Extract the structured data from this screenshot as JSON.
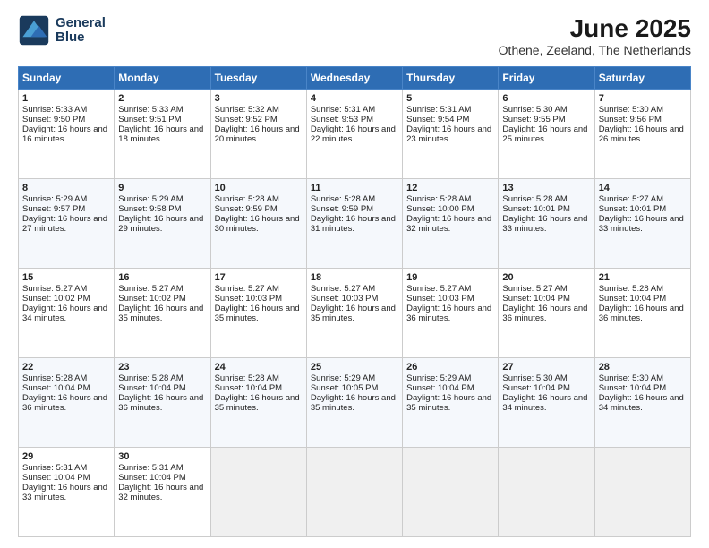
{
  "logo": {
    "line1": "General",
    "line2": "Blue"
  },
  "title": "June 2025",
  "subtitle": "Othene, Zeeland, The Netherlands",
  "weekdays": [
    "Sunday",
    "Monday",
    "Tuesday",
    "Wednesday",
    "Thursday",
    "Friday",
    "Saturday"
  ],
  "weeks": [
    [
      {
        "day": "1",
        "sunrise": "5:33 AM",
        "sunset": "9:50 PM",
        "daylight": "16 hours and 16 minutes."
      },
      {
        "day": "2",
        "sunrise": "5:33 AM",
        "sunset": "9:51 PM",
        "daylight": "16 hours and 18 minutes."
      },
      {
        "day": "3",
        "sunrise": "5:32 AM",
        "sunset": "9:52 PM",
        "daylight": "16 hours and 20 minutes."
      },
      {
        "day": "4",
        "sunrise": "5:31 AM",
        "sunset": "9:53 PM",
        "daylight": "16 hours and 22 minutes."
      },
      {
        "day": "5",
        "sunrise": "5:31 AM",
        "sunset": "9:54 PM",
        "daylight": "16 hours and 23 minutes."
      },
      {
        "day": "6",
        "sunrise": "5:30 AM",
        "sunset": "9:55 PM",
        "daylight": "16 hours and 25 minutes."
      },
      {
        "day": "7",
        "sunrise": "5:30 AM",
        "sunset": "9:56 PM",
        "daylight": "16 hours and 26 minutes."
      }
    ],
    [
      {
        "day": "8",
        "sunrise": "5:29 AM",
        "sunset": "9:57 PM",
        "daylight": "16 hours and 27 minutes."
      },
      {
        "day": "9",
        "sunrise": "5:29 AM",
        "sunset": "9:58 PM",
        "daylight": "16 hours and 29 minutes."
      },
      {
        "day": "10",
        "sunrise": "5:28 AM",
        "sunset": "9:59 PM",
        "daylight": "16 hours and 30 minutes."
      },
      {
        "day": "11",
        "sunrise": "5:28 AM",
        "sunset": "9:59 PM",
        "daylight": "16 hours and 31 minutes."
      },
      {
        "day": "12",
        "sunrise": "5:28 AM",
        "sunset": "10:00 PM",
        "daylight": "16 hours and 32 minutes."
      },
      {
        "day": "13",
        "sunrise": "5:28 AM",
        "sunset": "10:01 PM",
        "daylight": "16 hours and 33 minutes."
      },
      {
        "day": "14",
        "sunrise": "5:27 AM",
        "sunset": "10:01 PM",
        "daylight": "16 hours and 33 minutes."
      }
    ],
    [
      {
        "day": "15",
        "sunrise": "5:27 AM",
        "sunset": "10:02 PM",
        "daylight": "16 hours and 34 minutes."
      },
      {
        "day": "16",
        "sunrise": "5:27 AM",
        "sunset": "10:02 PM",
        "daylight": "16 hours and 35 minutes."
      },
      {
        "day": "17",
        "sunrise": "5:27 AM",
        "sunset": "10:03 PM",
        "daylight": "16 hours and 35 minutes."
      },
      {
        "day": "18",
        "sunrise": "5:27 AM",
        "sunset": "10:03 PM",
        "daylight": "16 hours and 35 minutes."
      },
      {
        "day": "19",
        "sunrise": "5:27 AM",
        "sunset": "10:03 PM",
        "daylight": "16 hours and 36 minutes."
      },
      {
        "day": "20",
        "sunrise": "5:27 AM",
        "sunset": "10:04 PM",
        "daylight": "16 hours and 36 minutes."
      },
      {
        "day": "21",
        "sunrise": "5:28 AM",
        "sunset": "10:04 PM",
        "daylight": "16 hours and 36 minutes."
      }
    ],
    [
      {
        "day": "22",
        "sunrise": "5:28 AM",
        "sunset": "10:04 PM",
        "daylight": "16 hours and 36 minutes."
      },
      {
        "day": "23",
        "sunrise": "5:28 AM",
        "sunset": "10:04 PM",
        "daylight": "16 hours and 36 minutes."
      },
      {
        "day": "24",
        "sunrise": "5:28 AM",
        "sunset": "10:04 PM",
        "daylight": "16 hours and 35 minutes."
      },
      {
        "day": "25",
        "sunrise": "5:29 AM",
        "sunset": "10:05 PM",
        "daylight": "16 hours and 35 minutes."
      },
      {
        "day": "26",
        "sunrise": "5:29 AM",
        "sunset": "10:04 PM",
        "daylight": "16 hours and 35 minutes."
      },
      {
        "day": "27",
        "sunrise": "5:30 AM",
        "sunset": "10:04 PM",
        "daylight": "16 hours and 34 minutes."
      },
      {
        "day": "28",
        "sunrise": "5:30 AM",
        "sunset": "10:04 PM",
        "daylight": "16 hours and 34 minutes."
      }
    ],
    [
      {
        "day": "29",
        "sunrise": "5:31 AM",
        "sunset": "10:04 PM",
        "daylight": "16 hours and 33 minutes."
      },
      {
        "day": "30",
        "sunrise": "5:31 AM",
        "sunset": "10:04 PM",
        "daylight": "16 hours and 32 minutes."
      },
      {
        "day": "",
        "sunrise": "",
        "sunset": "",
        "daylight": ""
      },
      {
        "day": "",
        "sunrise": "",
        "sunset": "",
        "daylight": ""
      },
      {
        "day": "",
        "sunrise": "",
        "sunset": "",
        "daylight": ""
      },
      {
        "day": "",
        "sunrise": "",
        "sunset": "",
        "daylight": ""
      },
      {
        "day": "",
        "sunrise": "",
        "sunset": "",
        "daylight": ""
      }
    ]
  ]
}
